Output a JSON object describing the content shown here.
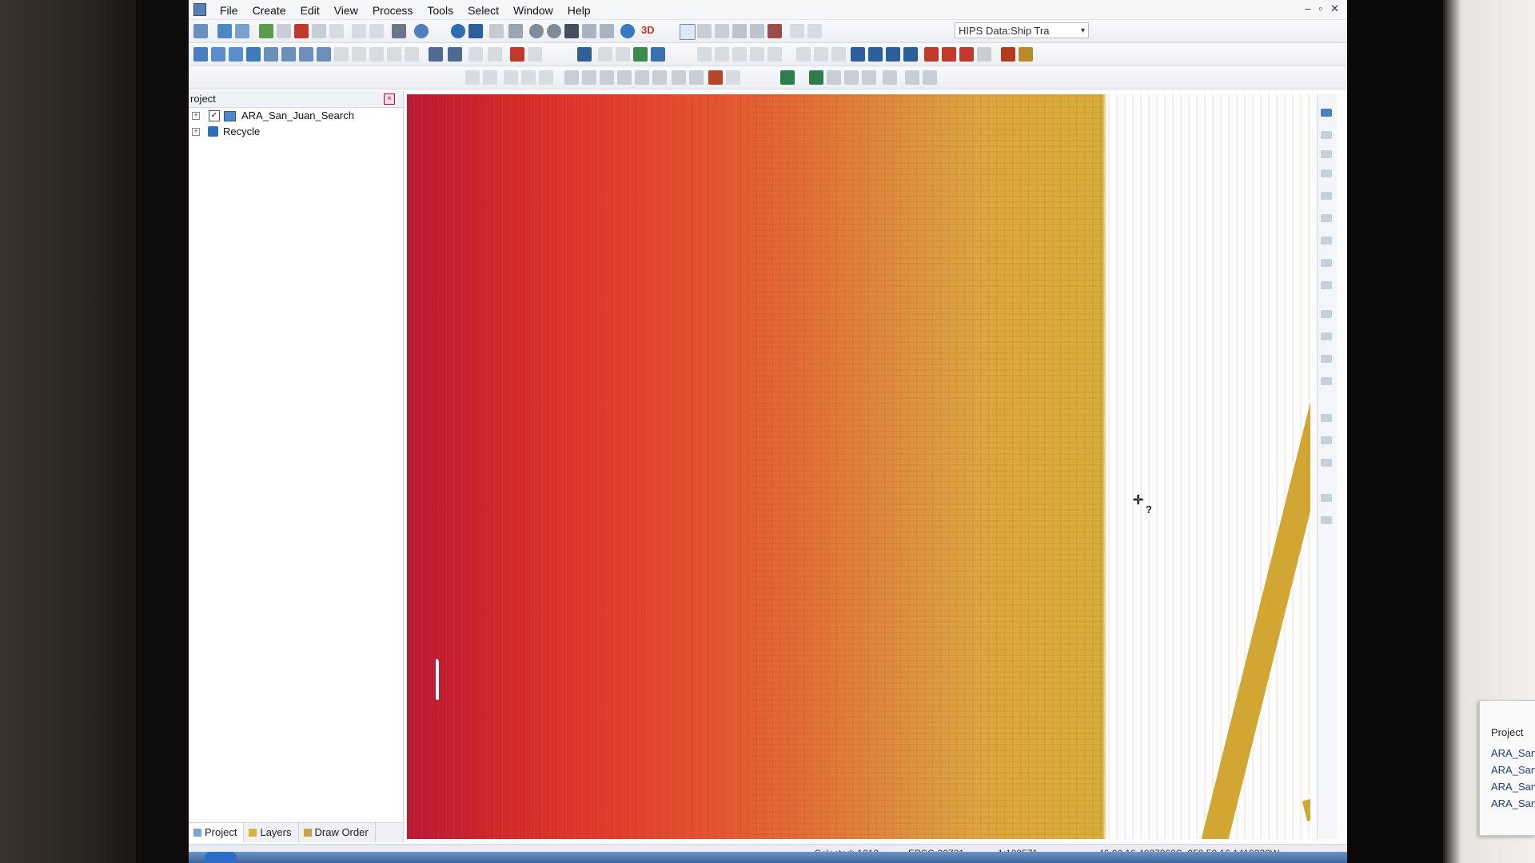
{
  "menubar": {
    "items": [
      "File",
      "Create",
      "Edit",
      "View",
      "Process",
      "Tools",
      "Select",
      "Window",
      "Help"
    ]
  },
  "toolbar": {
    "hips_combo_value": "HIPS Data:Ship Tra",
    "threed_label": "3D"
  },
  "project_panel": {
    "title": "roject",
    "tree": [
      {
        "label": "ARA_San_Juan_Search",
        "checked": true
      },
      {
        "label": "Recycle"
      }
    ],
    "tabs": [
      "Project",
      "Layers",
      "Draw Order"
    ]
  },
  "map": {
    "cursor_glyph": "?"
  },
  "statusbar": {
    "selected": "Selected: 1212",
    "epsg": "EPSG:32721",
    "scale": "1:128571",
    "coords": "46 00 16.4827369S, 059 58 16.1410339W"
  },
  "popup": {
    "title": "Project",
    "items": [
      "ARA_San",
      "ARA_San",
      "ARA_San",
      "ARA_San"
    ]
  },
  "colors": {
    "depth_deep": "#b81a35",
    "depth_shallow": "#d9ad3a",
    "accent": "#4d89c4"
  }
}
